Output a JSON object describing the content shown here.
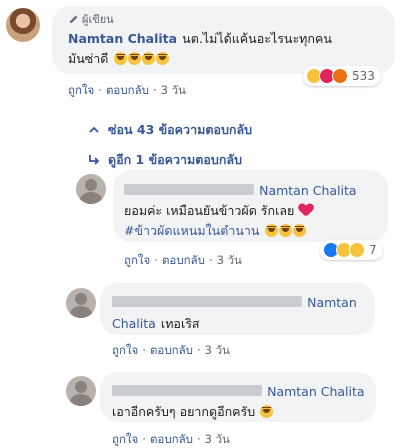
{
  "main_comment": {
    "author_tag": "ผู้เขียน",
    "author": "Namtan Chalita",
    "text_line1": "นต.ไม่ได้แค้นอะไรนะทุกคน",
    "text_line2": "มันซ่าดี",
    "reaction_count": "533",
    "actions": {
      "like": "ถูกใจ",
      "reply": "ตอบกลับ",
      "time": "3 วัน"
    }
  },
  "thread": {
    "hide_label": "ซ่อน 43 ข้อความตอบกลับ",
    "more_label": "ดูอีก 1 ข้อความตอบกลับ"
  },
  "replies": [
    {
      "mention": "Namtan Chalita",
      "text_line1": "ยอมค่ะ เหมือนยันข้าวผัด รักเลย",
      "text_line2": "#ข้าวผัดแหนมในตำนาน",
      "reaction_count": "7",
      "actions": {
        "like": "ถูกใจ",
        "reply": "ตอบกลับ",
        "time": "3 วัน"
      }
    },
    {
      "mention_part1": "Namtan",
      "mention_part2": "Chalita",
      "text": "เทอเริส",
      "actions": {
        "like": "ถูกใจ",
        "reply": "ตอบกลับ",
        "time": "3 วัน"
      }
    },
    {
      "mention": "Namtan Chalita",
      "text": "เอาอีกครับๆ อยากดูอีกครับ",
      "actions": {
        "like": "ถูกใจ",
        "reply": "ตอบกลับ",
        "time": "3 วัน"
      }
    }
  ],
  "colors": {
    "link": "#385898",
    "meta": "#606770",
    "bubble": "#f2f3f5",
    "heart": "#e0245e"
  }
}
